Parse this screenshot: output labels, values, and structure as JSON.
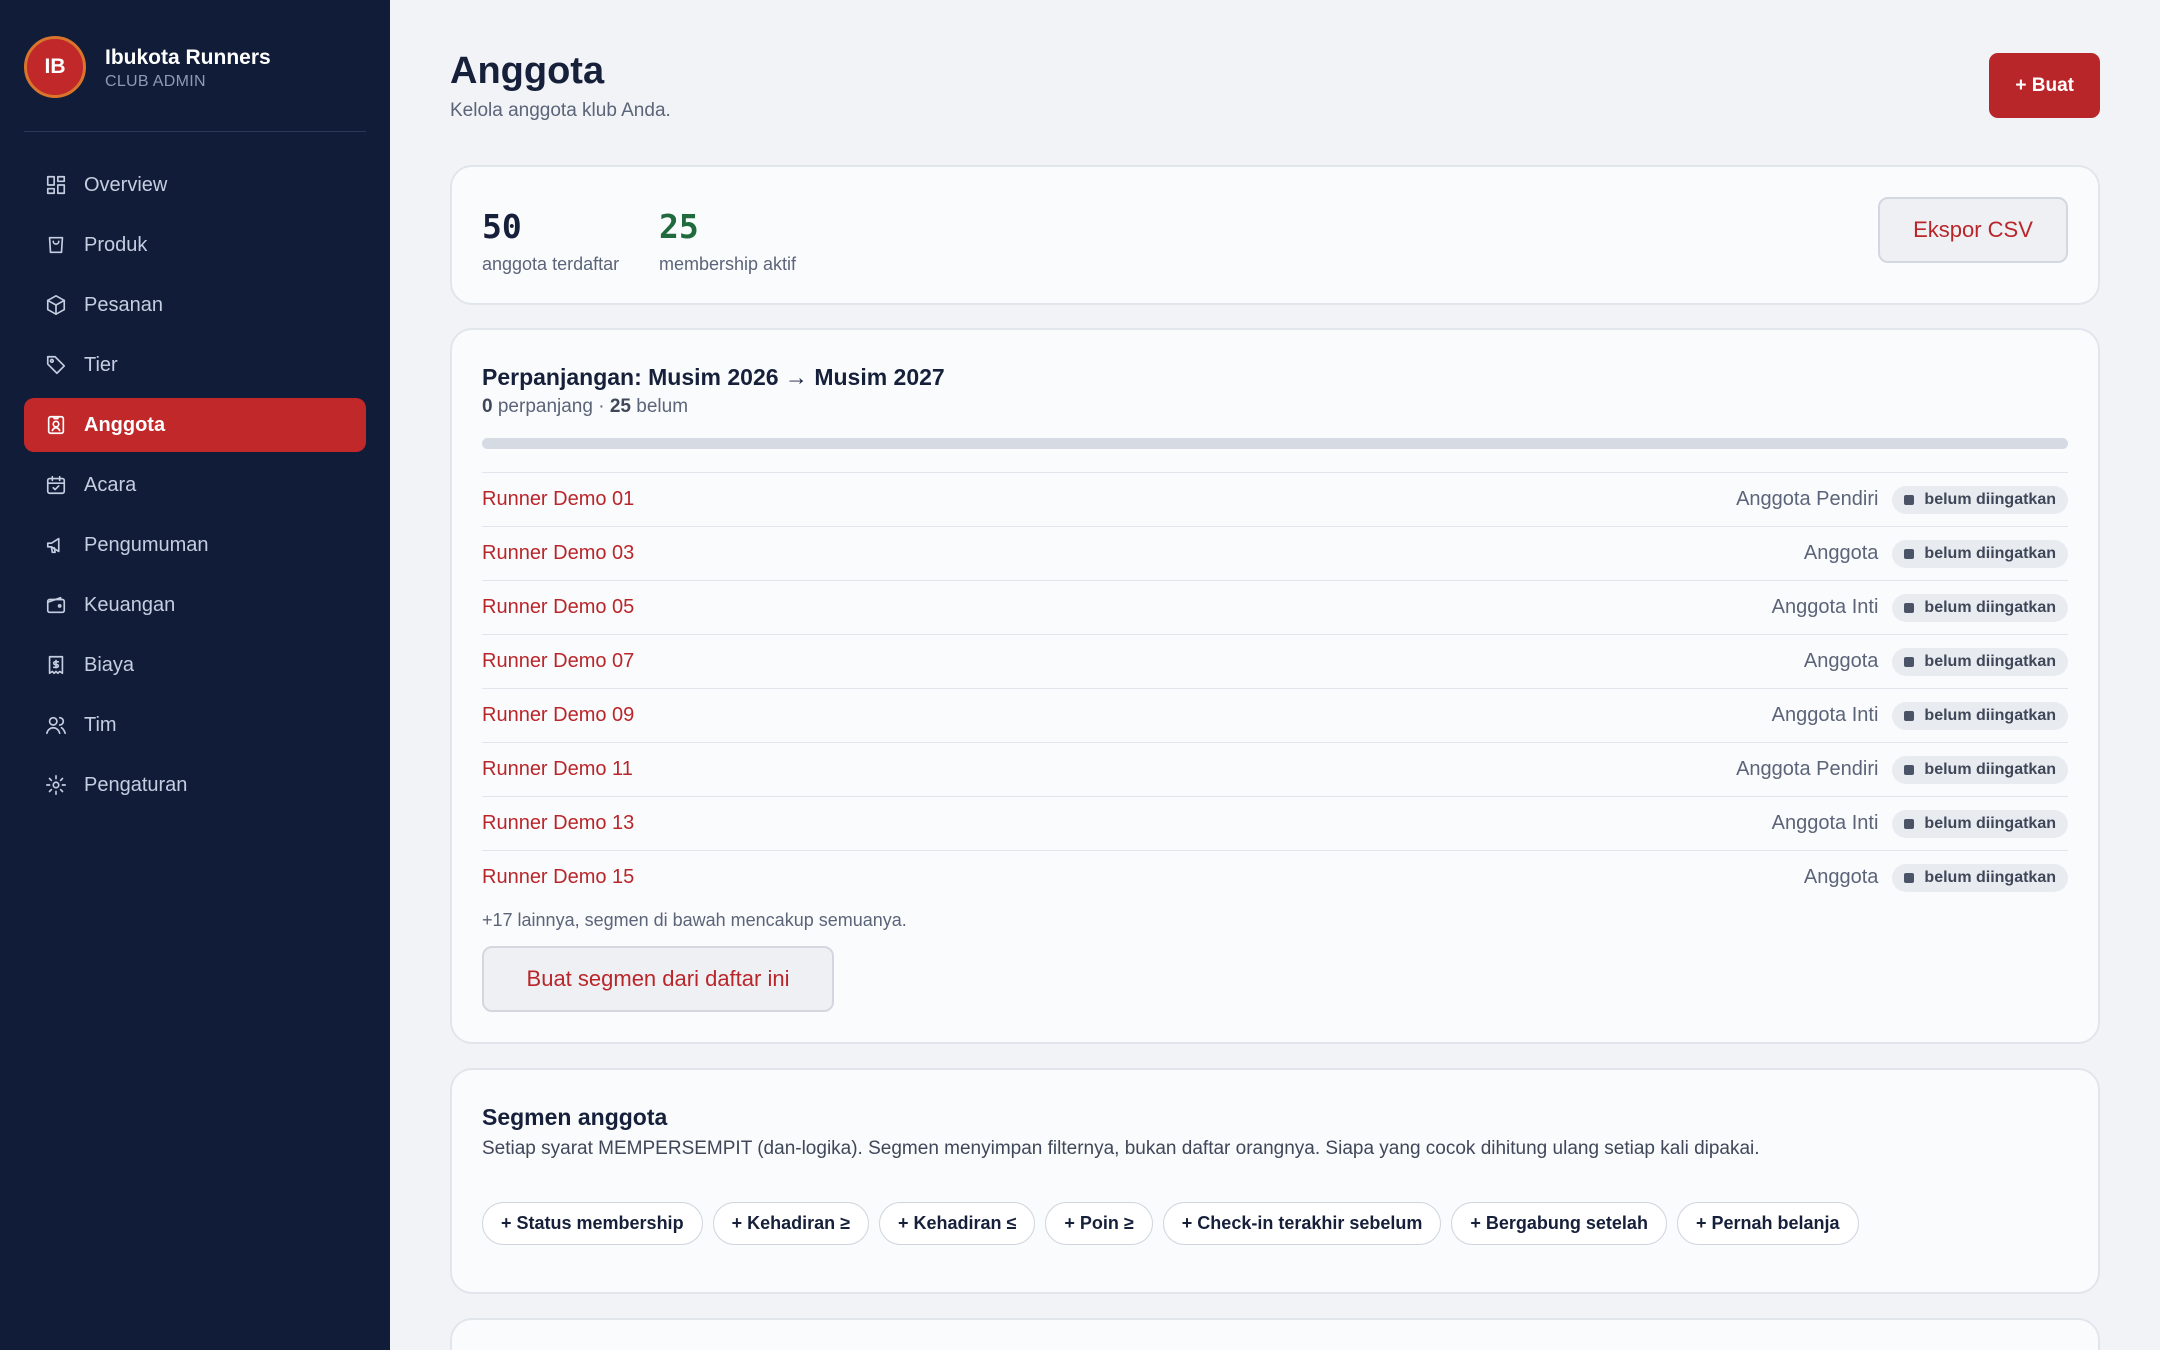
{
  "brand": {
    "initials": "IB",
    "name": "Ibukota Runners",
    "role": "CLUB ADMIN"
  },
  "nav": [
    {
      "label": "Overview",
      "icon": "grid-icon"
    },
    {
      "label": "Produk",
      "icon": "shopping-bag-icon"
    },
    {
      "label": "Pesanan",
      "icon": "package-icon"
    },
    {
      "label": "Tier",
      "icon": "tag-icon"
    },
    {
      "label": "Anggota",
      "icon": "member-badge-icon",
      "active": true
    },
    {
      "label": "Acara",
      "icon": "calendar-icon"
    },
    {
      "label": "Pengumuman",
      "icon": "megaphone-icon"
    },
    {
      "label": "Keuangan",
      "icon": "wallet-icon"
    },
    {
      "label": "Biaya",
      "icon": "receipt-icon"
    },
    {
      "label": "Tim",
      "icon": "users-icon"
    },
    {
      "label": "Pengaturan",
      "icon": "gear-icon"
    }
  ],
  "header": {
    "title": "Anggota",
    "subtitle": "Kelola anggota klub Anda.",
    "create_label": "+ Buat"
  },
  "stats": {
    "registered": {
      "value": "50",
      "label": "anggota terdaftar"
    },
    "active": {
      "value": "25",
      "label": "membership aktif"
    },
    "export_label": "Ekspor CSV"
  },
  "renewal": {
    "title": "Perpanjangan: Musim 2026 → Musim 2027",
    "renewed_count": "0",
    "renewed_label": "perpanjang",
    "separator": "·",
    "pending_count": "25",
    "pending_label": "belum",
    "progress_fraction": 0,
    "rows": [
      {
        "name": "Runner Demo 01",
        "tier": "Anggota Pendiri",
        "status": "belum diingatkan"
      },
      {
        "name": "Runner Demo 03",
        "tier": "Anggota",
        "status": "belum diingatkan"
      },
      {
        "name": "Runner Demo 05",
        "tier": "Anggota Inti",
        "status": "belum diingatkan"
      },
      {
        "name": "Runner Demo 07",
        "tier": "Anggota",
        "status": "belum diingatkan"
      },
      {
        "name": "Runner Demo 09",
        "tier": "Anggota Inti",
        "status": "belum diingatkan"
      },
      {
        "name": "Runner Demo 11",
        "tier": "Anggota Pendiri",
        "status": "belum diingatkan"
      },
      {
        "name": "Runner Demo 13",
        "tier": "Anggota Inti",
        "status": "belum diingatkan"
      },
      {
        "name": "Runner Demo 15",
        "tier": "Anggota",
        "status": "belum diingatkan"
      }
    ],
    "more_text": "+17 lainnya, segmen di bawah mencakup semuanya.",
    "segment_button_label": "Buat segmen dari daftar ini"
  },
  "segments": {
    "title": "Segmen anggota",
    "description": "Setiap syarat MEMPERSEMPIT (dan-logika). Segmen menyimpan filternya, bukan daftar orangnya. Siapa yang cocok dihitung ulang setiap kali dipakai.",
    "chips": [
      "+ Status membership",
      "+ Kehadiran ≥",
      "+ Kehadiran ≤",
      "+ Poin ≥",
      "+ Check-in terakhir sebelum",
      "+ Bergabung setelah",
      "+ Pernah belanja"
    ]
  },
  "colors": {
    "sidebar": "#111d38",
    "accent": "#b9262a",
    "success": "#1f6b3d",
    "background": "#f1f3f6"
  }
}
